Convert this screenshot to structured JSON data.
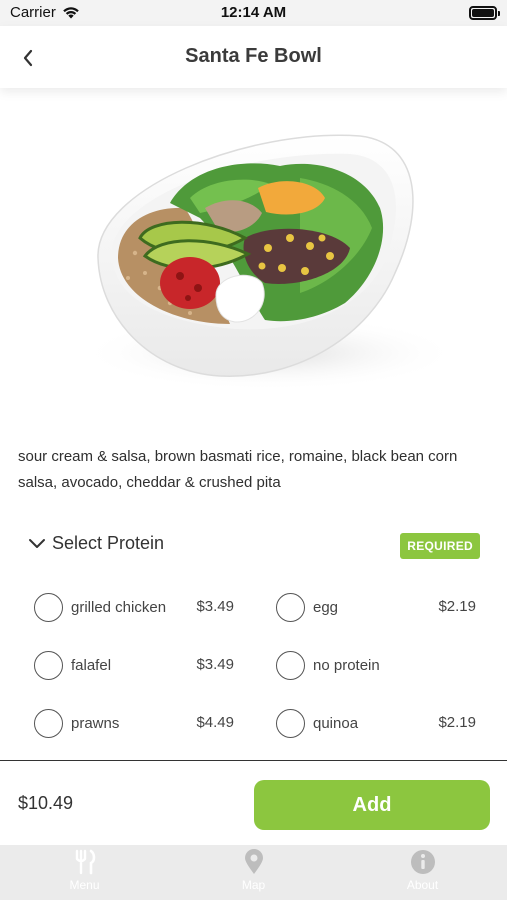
{
  "status_bar": {
    "carrier": "Carrier",
    "time": "12:14 AM"
  },
  "header": {
    "title": "Santa Fe Bowl"
  },
  "hero_image": {
    "subject": "Santa Fe Bowl salad photo"
  },
  "description": "sour cream & salsa, brown basmati rice, romaine, black bean corn salsa, avocado, cheddar & crushed pita",
  "protein_section": {
    "title": "Select Protein",
    "badge": "REQUIRED",
    "options": [
      {
        "label": "grilled chicken",
        "price": "$3.49"
      },
      {
        "label": "egg",
        "price": "$2.19"
      },
      {
        "label": "falafel",
        "price": "$3.49"
      },
      {
        "label": "no protein",
        "price": ""
      },
      {
        "label": "prawns",
        "price": "$4.49"
      },
      {
        "label": "quinoa",
        "price": "$2.19"
      }
    ]
  },
  "footer": {
    "total": "$10.49",
    "add_label": "Add"
  },
  "tab_bar": {
    "tabs": [
      {
        "label": "Menu",
        "icon": "fork-knife-icon"
      },
      {
        "label": "Map",
        "icon": "map-pin-icon"
      },
      {
        "label": "About",
        "icon": "info-icon"
      }
    ]
  },
  "colors": {
    "accent": "#8cc63f",
    "tab_bar": "#ebebeb",
    "tab_text": "#ffffff"
  }
}
